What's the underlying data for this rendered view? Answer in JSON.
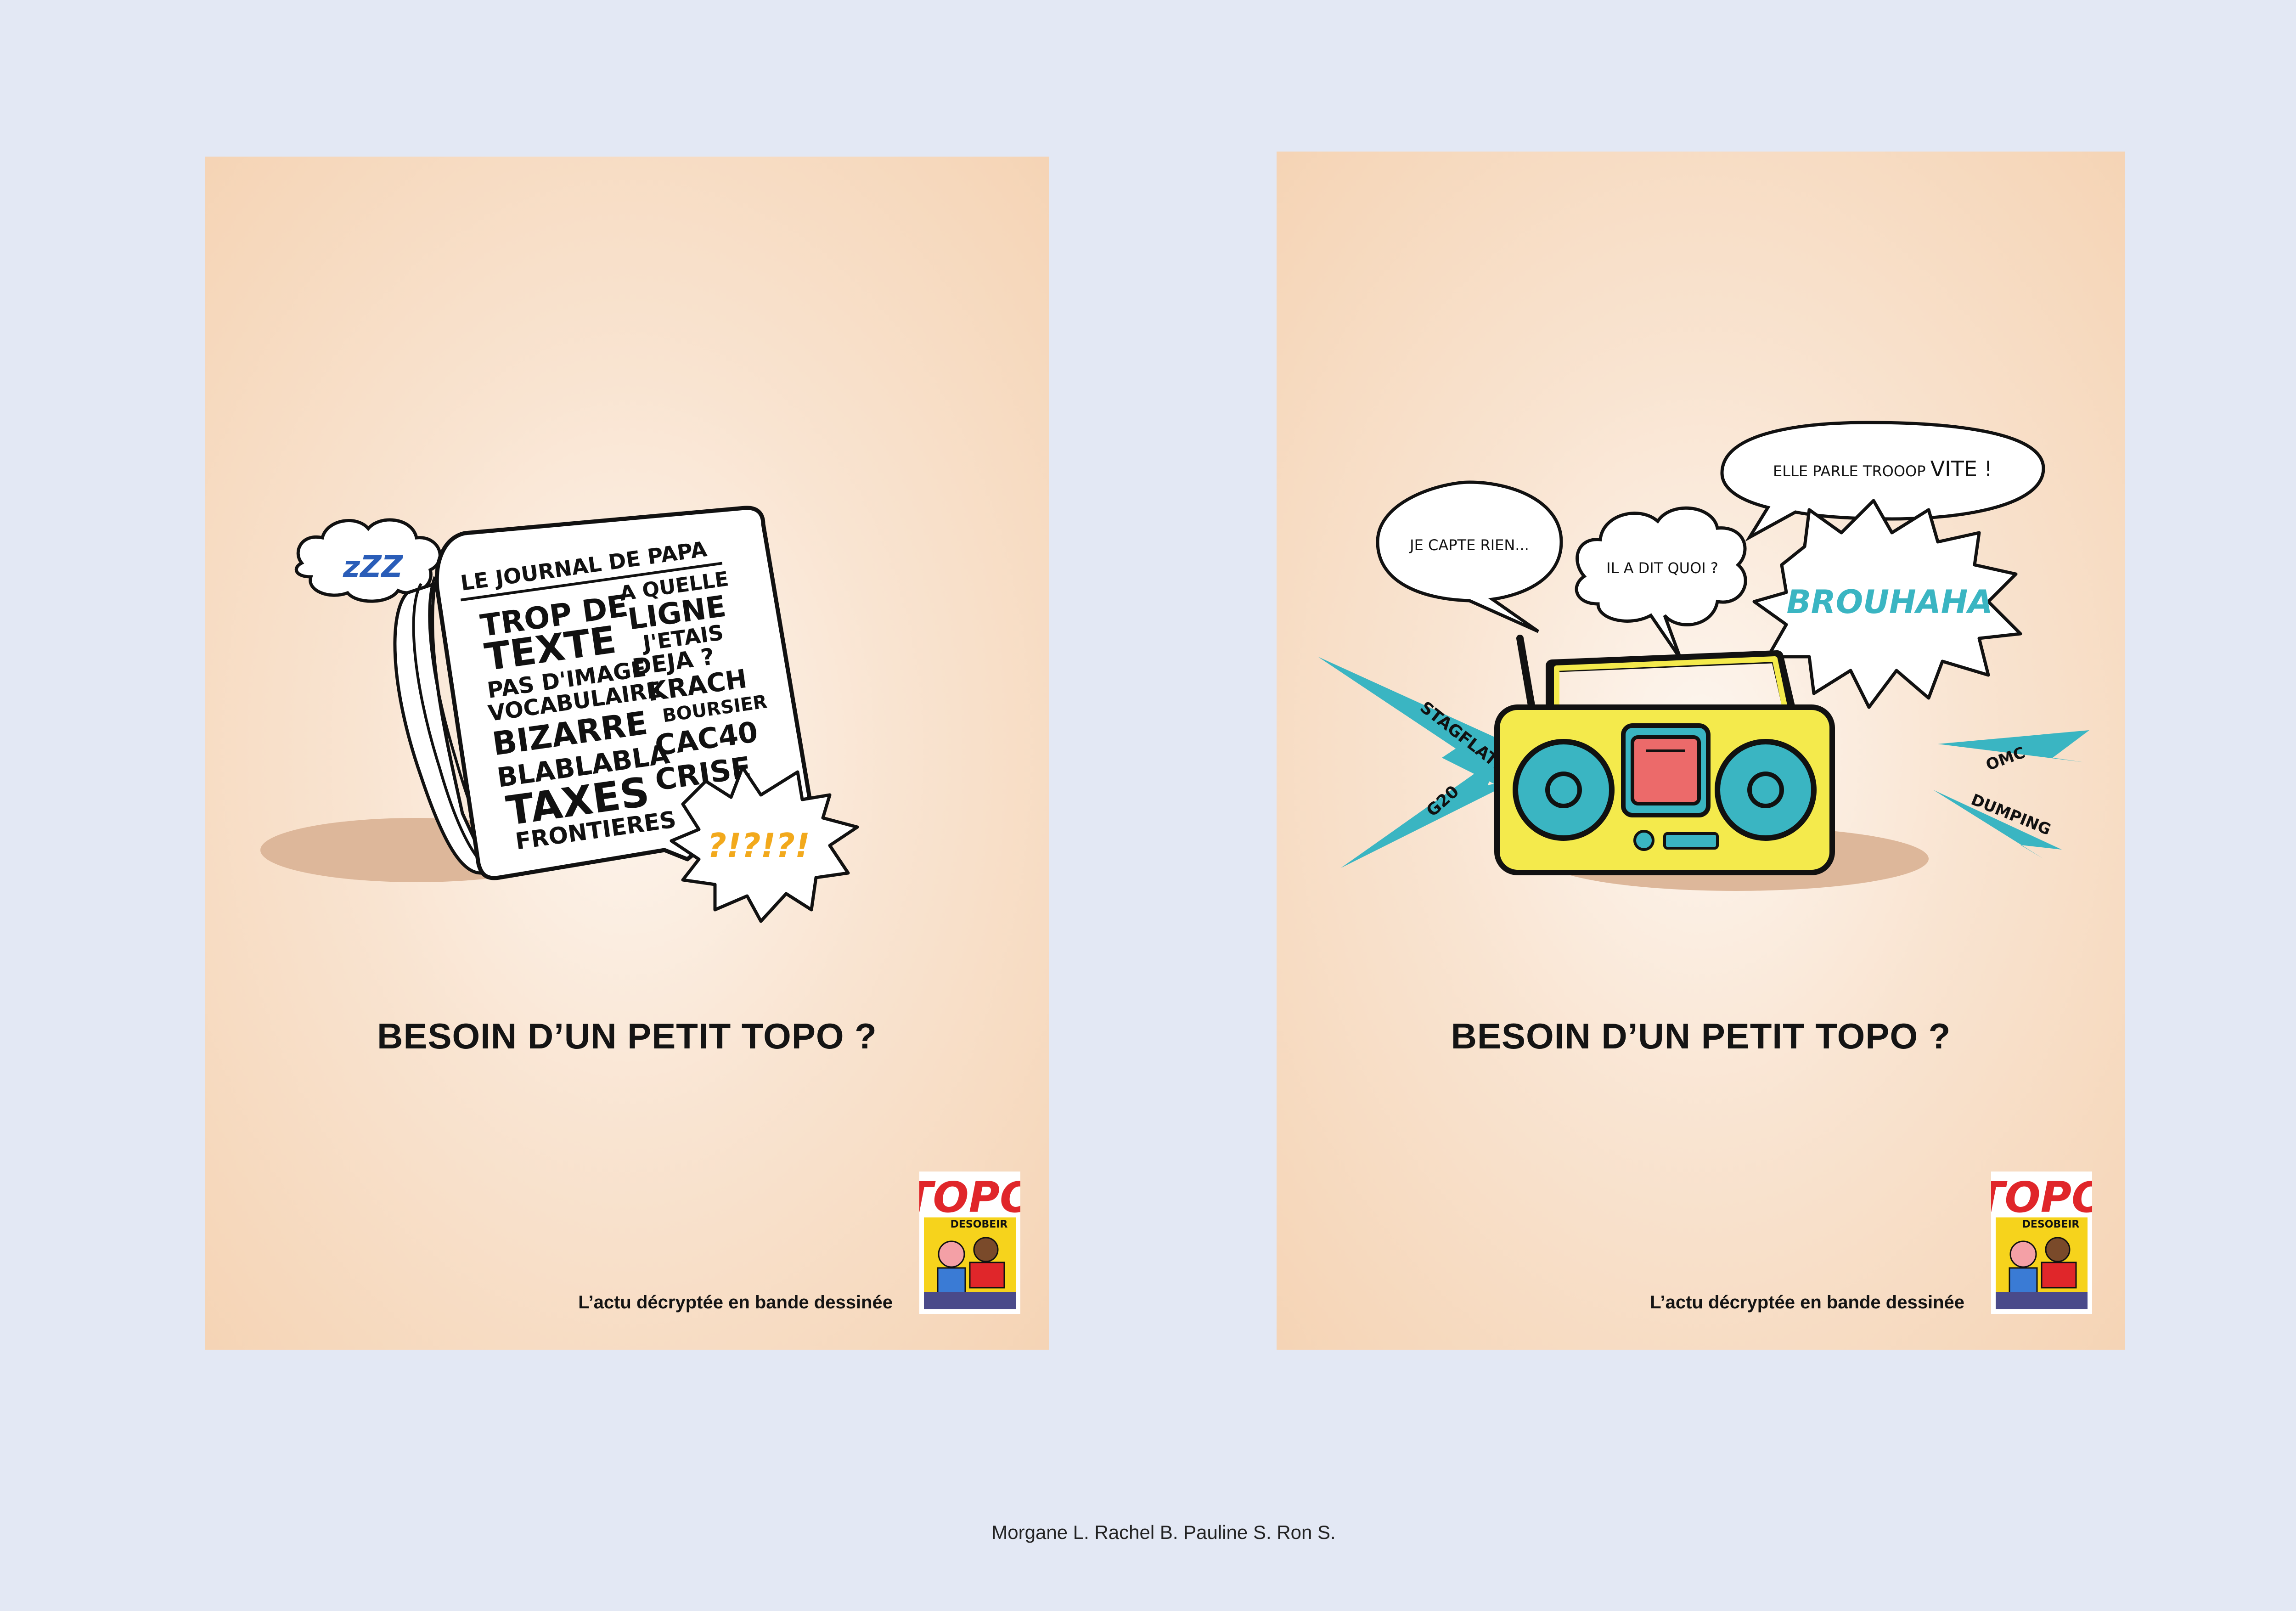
{
  "posters": [
    {
      "headline": "BESOIN D’UN PETIT TOPO ?",
      "tagline": "L’actu décryptée en bande dessinée",
      "illustration": {
        "sleep_cloud": "zZZ",
        "newspaper_title": "LE JOURNAL DE PAPA",
        "newspaper_words": [
          "TROP DE",
          "A QUELLE",
          "TEXTE",
          "LIGNE",
          "J'ETAIS",
          "PAS D'IMAGE",
          "DEJA ?",
          "VOCABULAIRE",
          "KRACH",
          "BIZARRE",
          "BOURSIER",
          "BLABLABLA",
          "CAC40",
          "TAXES",
          "CRISE",
          "FRONTIERES"
        ],
        "burst_text": "?!?!?!"
      },
      "magazine": {
        "title": "TOPO",
        "cover_word": "DESOBEIR"
      }
    },
    {
      "headline": "BESOIN D’UN PETIT TOPO ?",
      "tagline": "L’actu décryptée en bande dessinée",
      "illustration": {
        "bubble_1": "JE CAPTE RIEN...",
        "bubble_2": "IL A DIT QUOI ?",
        "bubble_3_prefix": "ELLE PARLE TROOOP ",
        "bubble_3_emph": "VITE !",
        "burst_text": "BROUHAHA",
        "sound_words": [
          "STAGFLATION",
          "G20",
          "OMC",
          "DUMPING"
        ]
      },
      "magazine": {
        "title": "TOPO",
        "cover_word": "DESOBEIR"
      }
    }
  ],
  "credits": "Morgane L. Rachel B. Pauline S. Ron S.",
  "colors": {
    "background": "#e3e8f4",
    "poster": "#f7dcc2",
    "radio_yellow": "#f4ea4c",
    "radio_teal": "#3ab5c2",
    "radio_red": "#ec6a6a",
    "burst_orange": "#f2a91c",
    "zzz_blue": "#2a5db8",
    "magazine_red": "#e0262a"
  }
}
